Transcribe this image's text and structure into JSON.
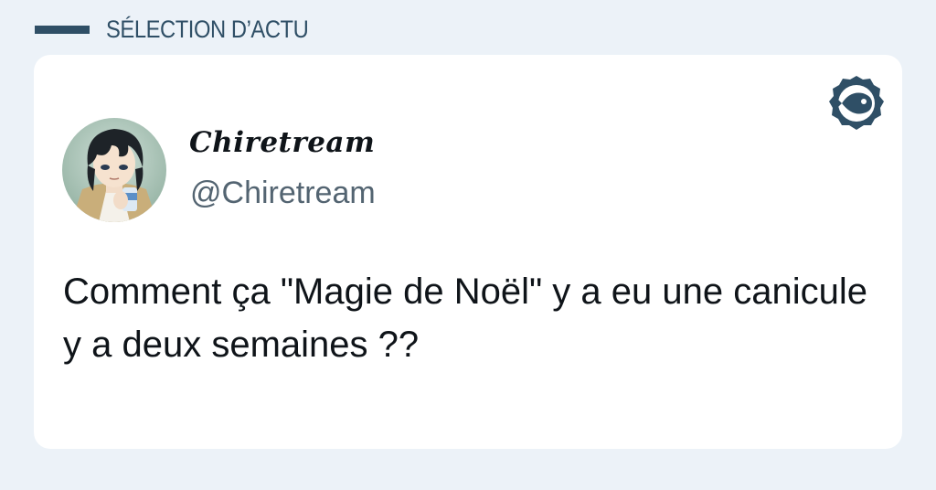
{
  "section": {
    "label": "SÉLECTION D’ACTU"
  },
  "tweet": {
    "display_name": "Chiretream",
    "handle": "@Chiretream",
    "text": "Comment ça \"Magie de Noël\" y a eu une canicule y a deux semaines ??"
  },
  "colors": {
    "page_background": "#ecf2f8",
    "accent": "#2f4f66",
    "card_background": "#ffffff",
    "text_primary": "#0f1419",
    "text_secondary": "#536471"
  },
  "icons": {
    "brand": "fish-badge-icon",
    "avatar": "anime-character-avatar"
  }
}
